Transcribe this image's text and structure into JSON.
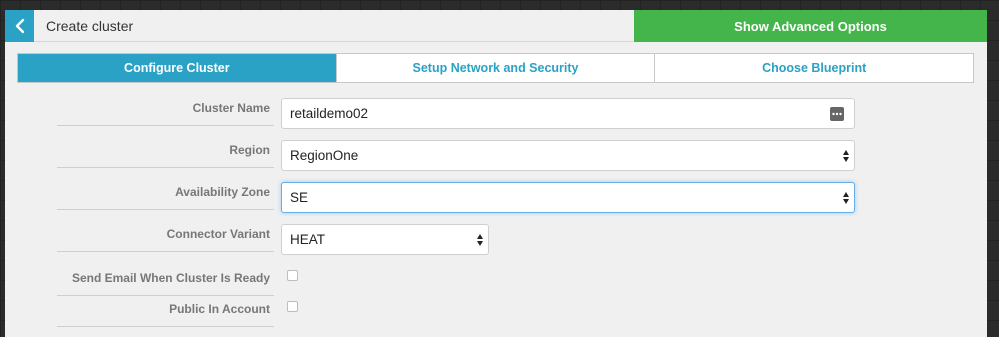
{
  "header": {
    "title": "Create cluster",
    "advanced_label": "Show Advanced Options"
  },
  "tabs": [
    {
      "label": "Configure Cluster",
      "active": true
    },
    {
      "label": "Setup Network and Security",
      "active": false
    },
    {
      "label": "Choose Blueprint",
      "active": false
    }
  ],
  "form": {
    "cluster_name": {
      "label": "Cluster Name",
      "value": "retaildemo02"
    },
    "region": {
      "label": "Region",
      "value": "RegionOne"
    },
    "availability_zone": {
      "label": "Availability Zone",
      "value": "SE"
    },
    "connector_variant": {
      "label": "Connector Variant",
      "value": "HEAT"
    },
    "send_email": {
      "label": "Send Email When Cluster Is Ready",
      "checked": false
    },
    "public_in_account": {
      "label": "Public In Account",
      "checked": false
    }
  },
  "colors": {
    "accent": "#2aa2c6",
    "advanced": "#44b54a"
  },
  "icons": {
    "back": "chevron-left-icon",
    "field_menu": "more-dots-icon",
    "select": "select-arrows-icon"
  }
}
